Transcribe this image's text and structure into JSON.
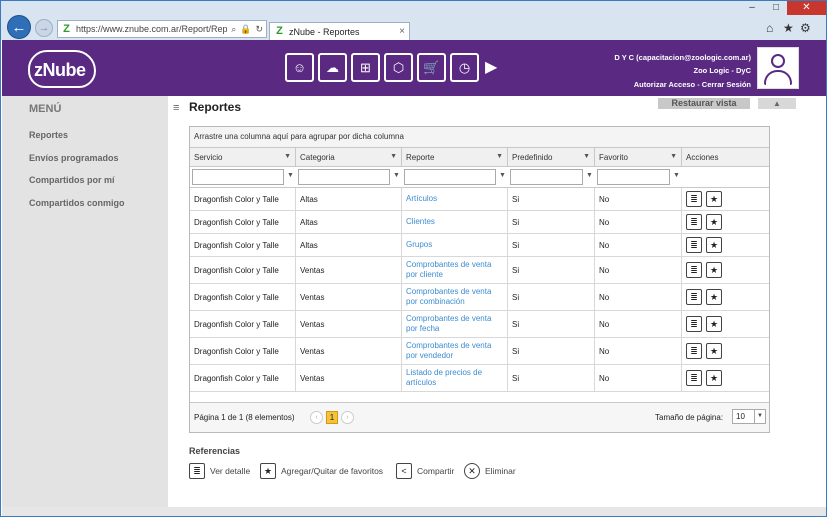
{
  "browser": {
    "url": "https://www.znube.com.ar/Report/Rep",
    "tab_title": "zNube - Reportes",
    "tab_close": "×",
    "favicon": "Z",
    "controls": {
      "min": "–",
      "max": "□",
      "close": "✕"
    },
    "icons": {
      "home": "⌂",
      "star": "★",
      "gear": "⚙"
    }
  },
  "header": {
    "logo": "zNube",
    "user_email": "D Y C (capacitacion@zoologic.com.ar)",
    "company": "Zoo Logic - DyC",
    "links": "Autorizar Acceso - Cerrar Sesión",
    "module_icons": [
      "☺",
      "☁",
      "⊞",
      "⬡",
      "🛒",
      "◷"
    ],
    "colors": {
      "brand": "#5a2a82"
    }
  },
  "sidebar": {
    "title": "MENÚ",
    "items": [
      {
        "label": "Reportes"
      },
      {
        "label": "Envíos programados"
      },
      {
        "label": "Compartidos por mí"
      },
      {
        "label": "Compartidos conmigo"
      }
    ]
  },
  "main": {
    "title": "Reportes",
    "restore_label": "Restaurar vista",
    "collapse_label": "▲"
  },
  "grid": {
    "group_hint": "Arrastre una columna aquí para agrupar por dicha columna",
    "columns": [
      "Servicio",
      "Categoria",
      "Reporte",
      "Predefinido",
      "Favorito",
      "Acciones"
    ],
    "rows": [
      {
        "servicio": "Dragonfish Color y Talle",
        "categoria": "Altas",
        "reporte": "Artículos",
        "predefinido": "Si",
        "favorito": "No"
      },
      {
        "servicio": "Dragonfish Color y Talle",
        "categoria": "Altas",
        "reporte": "Clientes",
        "predefinido": "Si",
        "favorito": "No"
      },
      {
        "servicio": "Dragonfish Color y Talle",
        "categoria": "Altas",
        "reporte": "Grupos",
        "predefinido": "Si",
        "favorito": "No"
      },
      {
        "servicio": "Dragonfish Color y Talle",
        "categoria": "Ventas",
        "reporte": "Comprobantes de venta por cliente",
        "predefinido": "Si",
        "favorito": "No"
      },
      {
        "servicio": "Dragonfish Color y Talle",
        "categoria": "Ventas",
        "reporte": "Comprobantes de venta por combinación",
        "predefinido": "Si",
        "favorito": "No"
      },
      {
        "servicio": "Dragonfish Color y Talle",
        "categoria": "Ventas",
        "reporte": "Comprobantes de venta por fecha",
        "predefinido": "Si",
        "favorito": "No"
      },
      {
        "servicio": "Dragonfish Color y Talle",
        "categoria": "Ventas",
        "reporte": "Comprobantes de venta por vendedor",
        "predefinido": "Si",
        "favorito": "No"
      },
      {
        "servicio": "Dragonfish Color y Talle",
        "categoria": "Ventas",
        "reporte": "Listado de precios de artículos",
        "predefinido": "Si",
        "favorito": "No"
      }
    ],
    "pager": {
      "info": "Página 1 de 1 (8 elementos)",
      "current_page": "1",
      "prev": "‹",
      "next": "›",
      "page_size_label": "Tamaño de página:",
      "page_size": "10"
    }
  },
  "references": {
    "title": "Referencias",
    "items": [
      {
        "icon": "≣",
        "label": "Ver detalle"
      },
      {
        "icon": "★",
        "label": "Agregar/Quitar de favoritos"
      },
      {
        "icon": "<",
        "label": "Compartir"
      },
      {
        "icon": "✕",
        "label": "Eliminar"
      }
    ]
  }
}
